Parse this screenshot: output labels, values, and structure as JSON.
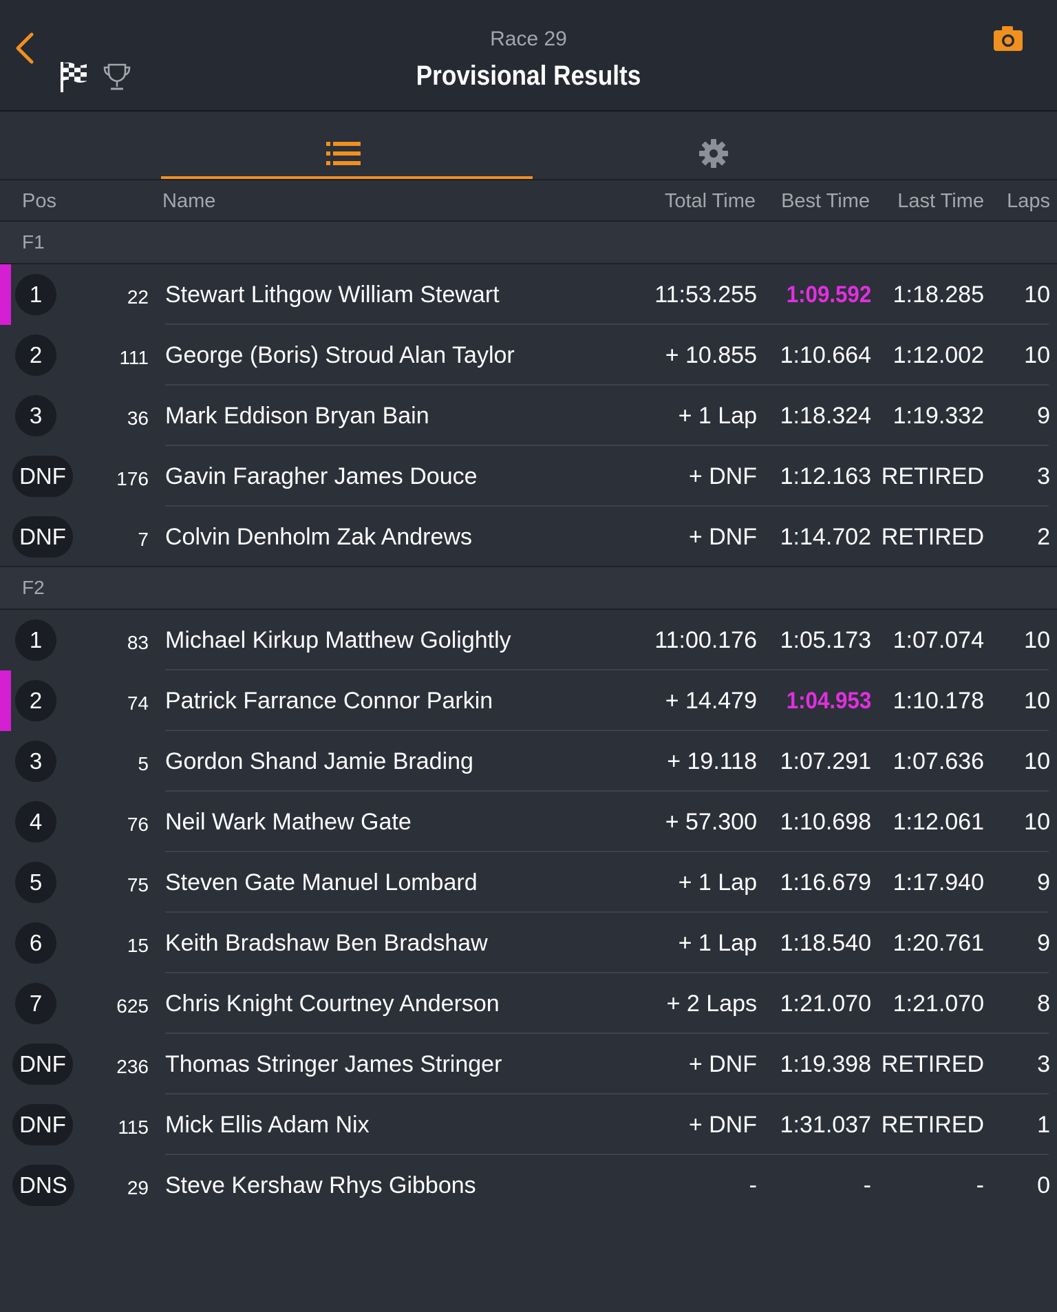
{
  "header": {
    "subtitle": "Race 29",
    "title": "Provisional Results",
    "back_icon": "chevron-left-icon",
    "flag_icon": "checkered-flag-icon",
    "trophy_icon": "trophy-icon",
    "camera_icon": "camera-icon"
  },
  "tabs": [
    {
      "icon": "list-icon",
      "active": true
    },
    {
      "icon": "gear-icon",
      "active": false
    }
  ],
  "columns": {
    "pos": "Pos",
    "name": "Name",
    "total": "Total Time",
    "best": "Best Time",
    "last": "Last Time",
    "laps": "Laps"
  },
  "colors": {
    "accent": "#f0901f",
    "fastest": "#e12fe0",
    "background": "#2c3039"
  },
  "sections": [
    {
      "label": "F1",
      "rows": [
        {
          "pos": "1",
          "num": "22",
          "name": "Stewart Lithgow William Stewart",
          "total": "11:53.255",
          "best": "1:09.592",
          "last": "1:18.285",
          "laps": "10",
          "fastest": true
        },
        {
          "pos": "2",
          "num": "111",
          "name": "George (Boris) Stroud Alan Taylor",
          "total": "+ 10.855",
          "best": "1:10.664",
          "last": "1:12.002",
          "laps": "10",
          "fastest": false
        },
        {
          "pos": "3",
          "num": "36",
          "name": "Mark Eddison Bryan Bain",
          "total": "+ 1 Lap",
          "best": "1:18.324",
          "last": "1:19.332",
          "laps": "9",
          "fastest": false
        },
        {
          "pos": "DNF",
          "num": "176",
          "name": "Gavin Faragher James Douce",
          "total": "+ DNF",
          "best": "1:12.163",
          "last": "RETIRED",
          "laps": "3",
          "fastest": false
        },
        {
          "pos": "DNF",
          "num": "7",
          "name": "Colvin Denholm Zak Andrews",
          "total": "+ DNF",
          "best": "1:14.702",
          "last": "RETIRED",
          "laps": "2",
          "fastest": false
        }
      ]
    },
    {
      "label": "F2",
      "rows": [
        {
          "pos": "1",
          "num": "83",
          "name": "Michael Kirkup Matthew Golightly",
          "total": "11:00.176",
          "best": "1:05.173",
          "last": "1:07.074",
          "laps": "10",
          "fastest": false
        },
        {
          "pos": "2",
          "num": "74",
          "name": "Patrick Farrance Connor Parkin",
          "total": "+ 14.479",
          "best": "1:04.953",
          "last": "1:10.178",
          "laps": "10",
          "fastest": true
        },
        {
          "pos": "3",
          "num": "5",
          "name": "Gordon Shand Jamie Brading",
          "total": "+ 19.118",
          "best": "1:07.291",
          "last": "1:07.636",
          "laps": "10",
          "fastest": false
        },
        {
          "pos": "4",
          "num": "76",
          "name": "Neil Wark Mathew Gate",
          "total": "+ 57.300",
          "best": "1:10.698",
          "last": "1:12.061",
          "laps": "10",
          "fastest": false
        },
        {
          "pos": "5",
          "num": "75",
          "name": "Steven Gate Manuel Lombard",
          "total": "+ 1 Lap",
          "best": "1:16.679",
          "last": "1:17.940",
          "laps": "9",
          "fastest": false
        },
        {
          "pos": "6",
          "num": "15",
          "name": "Keith Bradshaw Ben Bradshaw",
          "total": "+ 1 Lap",
          "best": "1:18.540",
          "last": "1:20.761",
          "laps": "9",
          "fastest": false
        },
        {
          "pos": "7",
          "num": "625",
          "name": "Chris Knight Courtney Anderson",
          "total": "+ 2 Laps",
          "best": "1:21.070",
          "last": "1:21.070",
          "laps": "8",
          "fastest": false
        },
        {
          "pos": "DNF",
          "num": "236",
          "name": "Thomas Stringer James Stringer",
          "total": "+ DNF",
          "best": "1:19.398",
          "last": "RETIRED",
          "laps": "3",
          "fastest": false
        },
        {
          "pos": "DNF",
          "num": "115",
          "name": "Mick Ellis Adam Nix",
          "total": "+ DNF",
          "best": "1:31.037",
          "last": "RETIRED",
          "laps": "1",
          "fastest": false
        },
        {
          "pos": "DNS",
          "num": "29",
          "name": "Steve Kershaw Rhys Gibbons",
          "total": "-",
          "best": "-",
          "last": "-",
          "laps": "0",
          "fastest": false
        }
      ]
    }
  ]
}
